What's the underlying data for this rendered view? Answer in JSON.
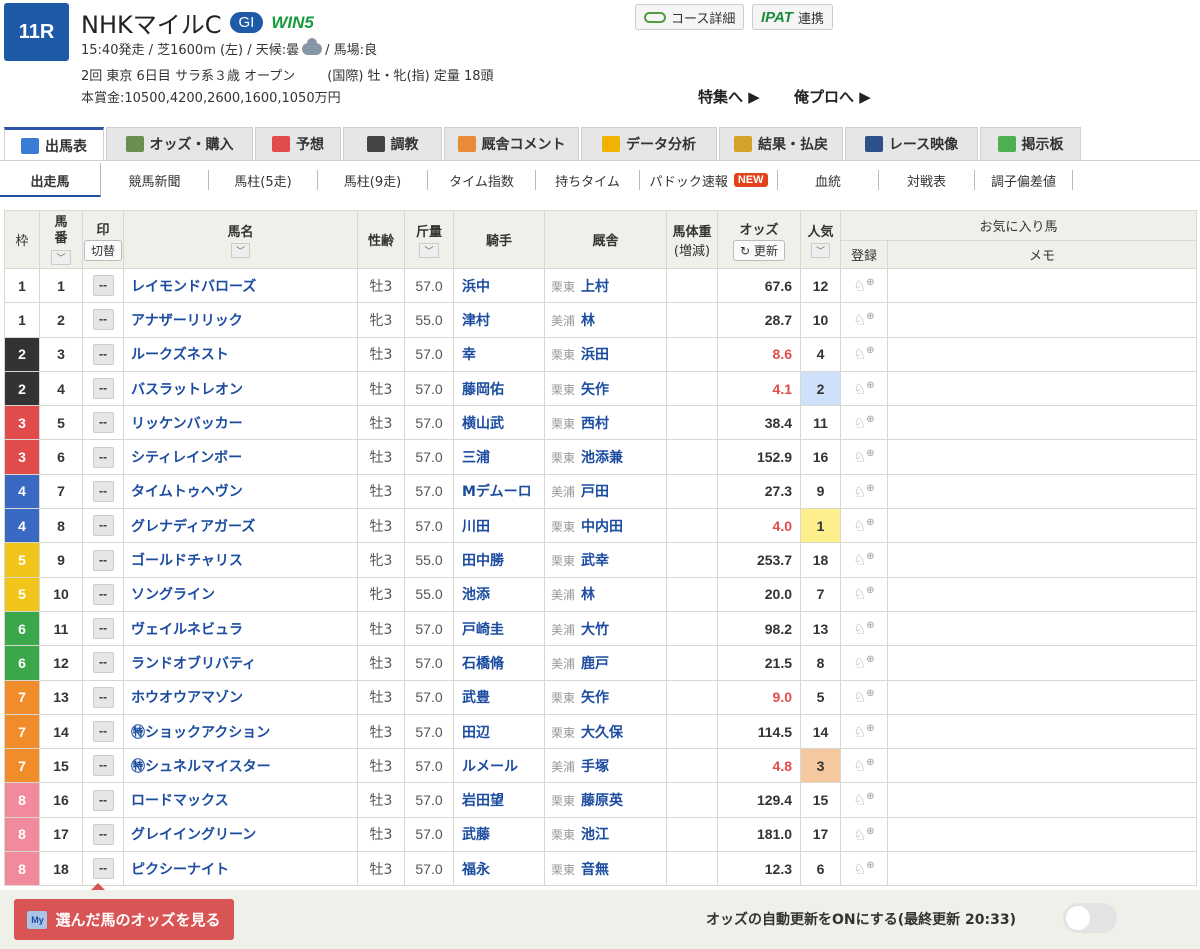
{
  "race": {
    "number": "11R",
    "name": "NHKマイルC",
    "grade": "GI",
    "win5": "WIN5",
    "line1a": "15:40発走 / 芝1600m (左) / 天候:曇",
    "line1b": "/ 馬場:良",
    "line2a": "2回 東京 6日目 サラ系３歳 オープン",
    "line2b": "(国際) 牡・牝(指) 定量 18頭",
    "line3": "本賞金:10500,4200,2600,1600,1050万円"
  },
  "top_buttons": {
    "course": "コース詳細",
    "ipat": "IPAT",
    "ipat_link": "連携"
  },
  "links": {
    "special": "特集へ ▶",
    "pro": "俺プロへ ▶"
  },
  "tabs": [
    {
      "label": "出馬表",
      "color": "#3a7bd5"
    },
    {
      "label": "オッズ・購入",
      "color": "#6b8e4e"
    },
    {
      "label": "予想",
      "color": "#e24b4b"
    },
    {
      "label": "調教",
      "color": "#444"
    },
    {
      "label": "厩舎コメント",
      "color": "#e88c3a"
    },
    {
      "label": "データ分析",
      "color": "#f0b400"
    },
    {
      "label": "結果・払戻",
      "color": "#d4a32b"
    },
    {
      "label": "レース映像",
      "color": "#2d4f8a"
    },
    {
      "label": "掲示板",
      "color": "#4caf50"
    }
  ],
  "subtabs": [
    "出走馬",
    "競馬新聞",
    "馬柱(5走)",
    "馬柱(9走)",
    "タイム指数",
    "持ちタイム",
    "パドック速報",
    "血統",
    "対戦表",
    "調子偏差値"
  ],
  "new_badge": "NEW",
  "headers": {
    "waku": "枠",
    "umaban": "馬\n番",
    "mark": "印",
    "mark_switch": "切替",
    "name": "馬名",
    "sexage": "性齢",
    "kinryo": "斤量",
    "jockey": "騎手",
    "stable": "厩舎",
    "weight": "馬体重",
    "weight2": "(増減)",
    "odds": "オッズ",
    "update": "更新",
    "pop": "人気",
    "fav": "お気に入り馬",
    "reg": "登録",
    "memo": "メモ",
    "chev": "﹀"
  },
  "entries": [
    {
      "w": "1",
      "n": "1",
      "name": "レイモンドバローズ",
      "sa": "牡3",
      "k": "57.0",
      "j": "浜中",
      "loc": "栗東",
      "t": "上村",
      "o": "67.6",
      "p": "12",
      "hot": false
    },
    {
      "w": "1",
      "n": "2",
      "name": "アナザーリリック",
      "sa": "牝3",
      "k": "55.0",
      "j": "津村",
      "loc": "美浦",
      "t": "林",
      "o": "28.7",
      "p": "10",
      "hot": false
    },
    {
      "w": "2",
      "n": "3",
      "name": "ルークズネスト",
      "sa": "牡3",
      "k": "57.0",
      "j": "幸",
      "loc": "栗東",
      "t": "浜田",
      "o": "8.6",
      "p": "4",
      "hot": true
    },
    {
      "w": "2",
      "n": "4",
      "name": "バスラットレオン",
      "sa": "牡3",
      "k": "57.0",
      "j": "藤岡佑",
      "loc": "栗東",
      "t": "矢作",
      "o": "4.1",
      "p": "2",
      "hot": true
    },
    {
      "w": "3",
      "n": "5",
      "name": "リッケンバッカー",
      "sa": "牡3",
      "k": "57.0",
      "j": "横山武",
      "loc": "栗東",
      "t": "西村",
      "o": "38.4",
      "p": "11",
      "hot": false
    },
    {
      "w": "3",
      "n": "6",
      "name": "シティレインボー",
      "sa": "牡3",
      "k": "57.0",
      "j": "三浦",
      "loc": "栗東",
      "t": "池添兼",
      "o": "152.9",
      "p": "16",
      "hot": false
    },
    {
      "w": "4",
      "n": "7",
      "name": "タイムトゥヘヴン",
      "sa": "牡3",
      "k": "57.0",
      "j": "Mデムーロ",
      "loc": "美浦",
      "t": "戸田",
      "o": "27.3",
      "p": "9",
      "hot": false
    },
    {
      "w": "4",
      "n": "8",
      "name": "グレナディアガーズ",
      "sa": "牡3",
      "k": "57.0",
      "j": "川田",
      "loc": "栗東",
      "t": "中内田",
      "o": "4.0",
      "p": "1",
      "hot": true
    },
    {
      "w": "5",
      "n": "9",
      "name": "ゴールドチャリス",
      "sa": "牝3",
      "k": "55.0",
      "j": "田中勝",
      "loc": "栗東",
      "t": "武幸",
      "o": "253.7",
      "p": "18",
      "hot": false
    },
    {
      "w": "5",
      "n": "10",
      "name": "ソングライン",
      "sa": "牝3",
      "k": "55.0",
      "j": "池添",
      "loc": "美浦",
      "t": "林",
      "o": "20.0",
      "p": "7",
      "hot": false
    },
    {
      "w": "6",
      "n": "11",
      "name": "ヴェイルネビュラ",
      "sa": "牡3",
      "k": "57.0",
      "j": "戸崎圭",
      "loc": "美浦",
      "t": "大竹",
      "o": "98.2",
      "p": "13",
      "hot": false
    },
    {
      "w": "6",
      "n": "12",
      "name": "ランドオブリバティ",
      "sa": "牡3",
      "k": "57.0",
      "j": "石橋脩",
      "loc": "美浦",
      "t": "鹿戸",
      "o": "21.5",
      "p": "8",
      "hot": false
    },
    {
      "w": "7",
      "n": "13",
      "name": "ホウオウアマゾン",
      "sa": "牡3",
      "k": "57.0",
      "j": "武豊",
      "loc": "栗東",
      "t": "矢作",
      "o": "9.0",
      "p": "5",
      "hot": true
    },
    {
      "w": "7",
      "n": "14",
      "name": "㊕ショックアクション",
      "sa": "牡3",
      "k": "57.0",
      "j": "田辺",
      "loc": "栗東",
      "t": "大久保",
      "o": "114.5",
      "p": "14",
      "hot": false
    },
    {
      "w": "7",
      "n": "15",
      "name": "㊕シュネルマイスター",
      "sa": "牡3",
      "k": "57.0",
      "j": "ルメール",
      "loc": "美浦",
      "t": "手塚",
      "o": "4.8",
      "p": "3",
      "hot": true
    },
    {
      "w": "8",
      "n": "16",
      "name": "ロードマックス",
      "sa": "牡3",
      "k": "57.0",
      "j": "岩田望",
      "loc": "栗東",
      "t": "藤原英",
      "o": "129.4",
      "p": "15",
      "hot": false
    },
    {
      "w": "8",
      "n": "17",
      "name": "グレイイングリーン",
      "sa": "牡3",
      "k": "57.0",
      "j": "武藤",
      "loc": "栗東",
      "t": "池江",
      "o": "181.0",
      "p": "17",
      "hot": false
    },
    {
      "w": "8",
      "n": "18",
      "name": "ピクシーナイト",
      "sa": "牡3",
      "k": "57.0",
      "j": "福永",
      "loc": "栗東",
      "t": "音無",
      "o": "12.3",
      "p": "6",
      "hot": false
    }
  ],
  "mark_symbol": "--",
  "frame_colors": {
    "1": [
      "#ffffff",
      "#333"
    ],
    "2": [
      "#333333",
      "#fff"
    ],
    "3": [
      "#e24b4b",
      "#fff"
    ],
    "4": [
      "#3a69c4",
      "#fff"
    ],
    "5": [
      "#f0c419",
      "#fff"
    ],
    "6": [
      "#3aa84a",
      "#fff"
    ],
    "7": [
      "#f08c2a",
      "#fff"
    ],
    "8": [
      "#f08a9c",
      "#fff"
    ]
  },
  "pop_colors": {
    "1": "#fdf08c",
    "2": "#cfe0fb",
    "3": "#f5c8a0"
  },
  "footer": {
    "button": "選んだ馬のオッズを見る",
    "my": "My",
    "auto": "オッズの自動更新をONにする(最終更新 20:33)"
  }
}
